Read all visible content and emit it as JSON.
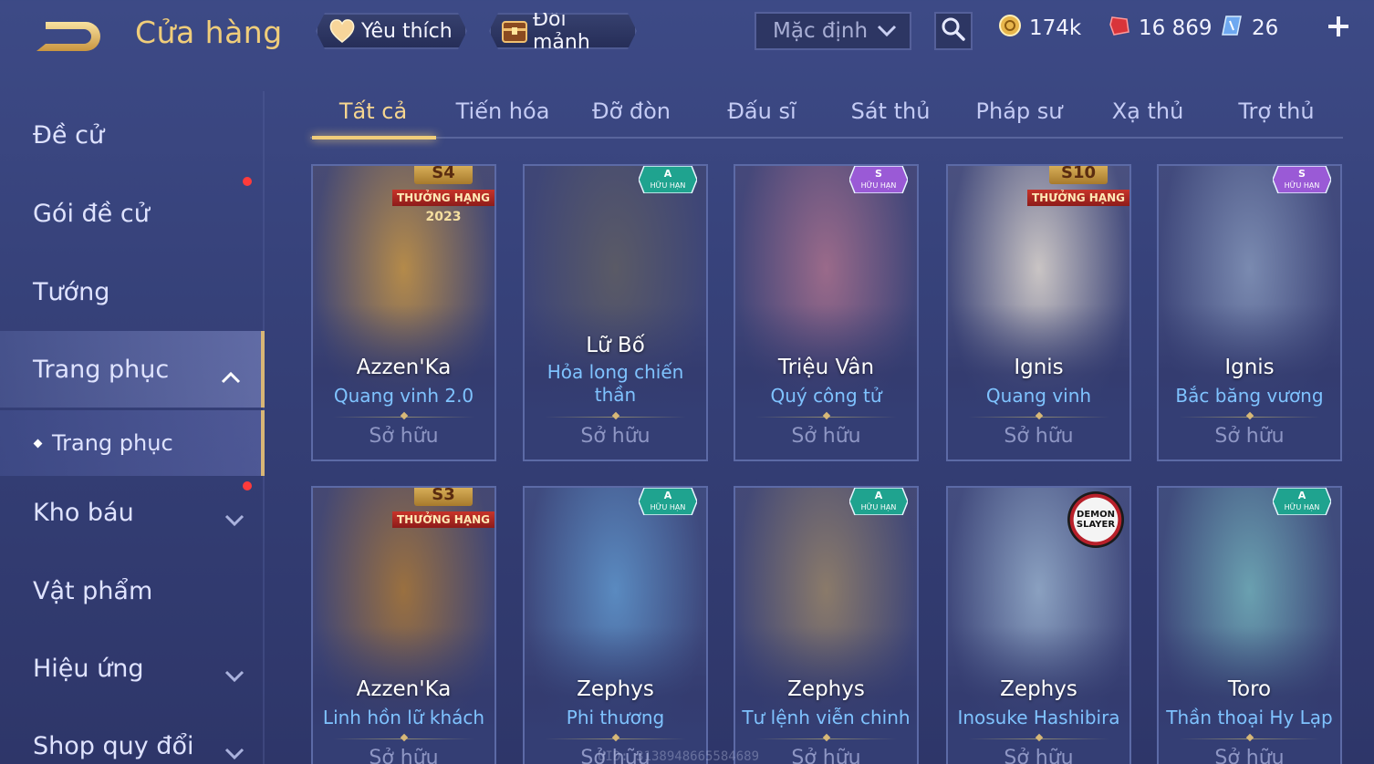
{
  "header": {
    "title": "Cửa hàng",
    "favorites_label": "Yêu thích",
    "exchange_label": "Đổi mảnh",
    "sort_value": "Mặc định",
    "currencies": [
      {
        "icon": "gold-coin-icon",
        "value": "174k"
      },
      {
        "icon": "red-coupon-icon",
        "value": "16 869"
      },
      {
        "icon": "blue-gem-icon",
        "value": "26"
      }
    ]
  },
  "sidebar": {
    "items": [
      {
        "label": "Đề cử"
      },
      {
        "label": "Gói đề cử"
      },
      {
        "label": "Tướng"
      },
      {
        "label": "Trang phục"
      },
      {
        "label": "Trang phục"
      },
      {
        "label": "Kho báu"
      },
      {
        "label": "Vật phẩm"
      },
      {
        "label": "Hiệu ứng"
      },
      {
        "label": "Shop quy đổi"
      }
    ]
  },
  "tabs": [
    "Tất cả",
    "Tiến hóa",
    "Đỡ đòn",
    "Đấu sĩ",
    "Sát thủ",
    "Pháp sư",
    "Xạ thủ",
    "Trợ thủ"
  ],
  "cards": [
    {
      "hero": "Azzen'Ka",
      "skin": "Quang vinh 2.0",
      "status": "Sở hữu",
      "badge": "rank",
      "season": "S4",
      "rank_label": "THƯỞNG HẠNG",
      "year": "2023",
      "art_color": "#b48a4a"
    },
    {
      "hero": "Lữ Bố",
      "skin": "Hỏa long chiến thần",
      "status": "Sở hữu",
      "badge": "tier",
      "tier": "A",
      "tier_label": "HỮU HẠN",
      "art_color": "#5a5a66"
    },
    {
      "hero": "Triệu Vân",
      "skin": "Quý công tử",
      "status": "Sở hữu",
      "badge": "tier-s",
      "tier": "S",
      "tier_label": "HỮU HẠN",
      "art_color": "#9a6a8a"
    },
    {
      "hero": "Ignis",
      "skin": "Quang vinh",
      "status": "Sở hữu",
      "badge": "rank",
      "season": "S10",
      "rank_label": "THƯỞNG HẠNG",
      "year": "",
      "art_color": "#c9c4c4"
    },
    {
      "hero": "Ignis",
      "skin": "Bắc băng vương",
      "status": "Sở hữu",
      "badge": "tier-s",
      "tier": "S",
      "tier_label": "HỮU HẠN",
      "art_color": "#7a8ab0"
    },
    {
      "hero": "Azzen'Ka",
      "skin": "Linh hồn lữ khách",
      "status": "Sở hữu",
      "badge": "rank",
      "season": "S3",
      "rank_label": "THƯỞNG HẠNG",
      "year": "",
      "art_color": "#9a7040"
    },
    {
      "hero": "Zephys",
      "skin": "Phi thương",
      "status": "Sở hữu",
      "badge": "tier",
      "tier": "A",
      "tier_label": "HỮU HẠN",
      "art_color": "#5a8ac0"
    },
    {
      "hero": "Zephys",
      "skin": "Tư lệnh viễn chinh",
      "status": "Sở hữu",
      "badge": "tier",
      "tier": "A",
      "tier_label": "HỮU HẠN",
      "art_color": "#8a7a6a"
    },
    {
      "hero": "Zephys",
      "skin": "Inosuke Hashibira",
      "status": "Sở hữu",
      "badge": "collab",
      "collab_label": "DEMON SLAYER",
      "art_color": "#8aa0c0"
    },
    {
      "hero": "Toro",
      "skin": "Thần thoại Hy Lạp",
      "status": "Sở hữu",
      "badge": "tier",
      "tier": "A",
      "tier_label": "HỮU HẠN",
      "art_color": "#6aa0b0"
    }
  ],
  "watermark": "UID: 3138948665584689",
  "colors": {
    "accent_gold": "#f0cd7a",
    "skin_blue": "#7fc3ff",
    "tier_a": "#1fa38f",
    "tier_s": "#9a5ad6",
    "notify_red": "#ff3b3b"
  }
}
